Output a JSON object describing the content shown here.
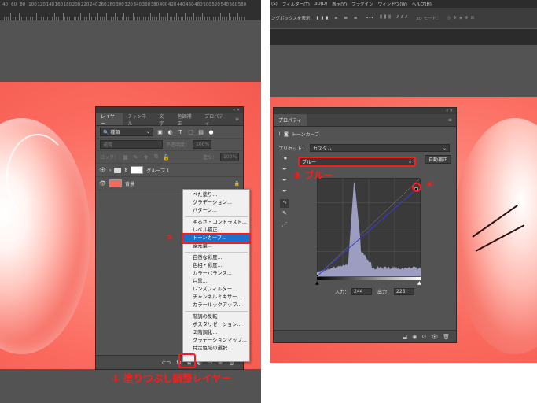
{
  "left": {
    "ruler_labels": [
      "40",
      "60",
      "80",
      "100",
      "120",
      "140",
      "160",
      "180",
      "200",
      "220",
      "240",
      "260",
      "280",
      "300",
      "320",
      "340",
      "360",
      "380",
      "400",
      "420",
      "440",
      "460",
      "480",
      "500",
      "520",
      "540",
      "560",
      "580"
    ],
    "layers_panel": {
      "tabs": [
        "レイヤー",
        "チャンネル",
        "文字",
        "色調補正",
        "プロパティ"
      ],
      "filter_kind": "種類",
      "blend_mode": "通常",
      "opacity_label": "不透明度：",
      "opacity_value": "100%",
      "lock_label": "ロック：",
      "fill_label": "塗り：",
      "fill_value": "100%",
      "layers": [
        {
          "name": "グループ 1",
          "type": "group"
        },
        {
          "name": "背景",
          "type": "background"
        }
      ],
      "footer_icons": [
        "link-icon",
        "fx-icon",
        "mask-icon",
        "adjustment-icon",
        "folder-icon",
        "new-layer-icon",
        "trash-icon"
      ]
    },
    "adjust_menu": {
      "groups": [
        [
          "べた塗り...",
          "グラデーション...",
          "パターン..."
        ],
        [
          "明るさ・コントラスト...",
          "レベル補正...",
          "トーンカーブ...",
          "露光量..."
        ],
        [
          "自然な彩度...",
          "色相・彩度...",
          "カラーバランス...",
          "白黒...",
          "レンズフィルター...",
          "チャンネルミキサー...",
          "カラールックアップ..."
        ],
        [
          "階調の反転",
          "ポスタリゼーション...",
          "２階調化...",
          "グラデーションマップ...",
          "特定色域の選択..."
        ]
      ],
      "selected": "トーンカーブ..."
    },
    "annotations": {
      "step1": "① 塗りつぶし調整レイヤー",
      "step2": "②"
    }
  },
  "right": {
    "menubar": [
      "(S)",
      "フィルター(T)",
      "3D(D)",
      "表示(V)",
      "プラグイン",
      "ウィンドウ(W)",
      "ヘルプ(H)"
    ],
    "options_bar": {
      "text1": "ングボックスを表示",
      "mode_3d": "3D モード："
    },
    "properties_panel": {
      "title": "プロパティ",
      "subtitle": "トーンカーブ",
      "preset_label": "プリセット：",
      "preset_value": "カスタム",
      "channel_value": "ブルー",
      "auto_button": "自動補正",
      "input_label": "入力：",
      "input_value": "244",
      "output_label": "出力：",
      "output_value": "225"
    },
    "curve": {
      "channel": "blue",
      "points": [
        [
          0,
          0
        ],
        [
          244,
          225
        ]
      ],
      "histogram_color": "#a9a9d1",
      "line_color": "#3b3bd8"
    },
    "annotations": {
      "step3": "③ ブルー",
      "step4": "④"
    }
  },
  "colors": {
    "annotation_red": "#ff1a1a",
    "highlight_blue": "#1b72c8",
    "panel_bg": "#535353",
    "canvas_red": "#f45a4f"
  }
}
